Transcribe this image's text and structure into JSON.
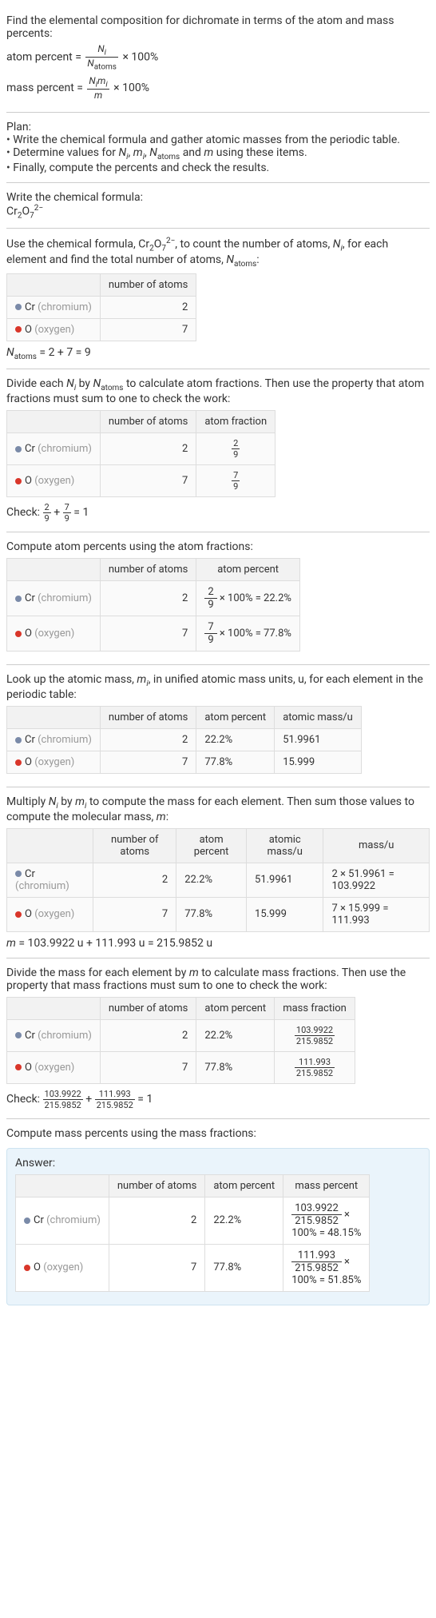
{
  "intro": {
    "line1": "Find the elemental composition for dichromate in terms of the atom and mass percents:",
    "atom_percent_lhs": "atom percent = ",
    "atom_percent_num": "N",
    "atom_percent_num_sub": "i",
    "atom_percent_den": "N",
    "atom_percent_den_sub": "atoms",
    "times100": " × 100%",
    "mass_percent_lhs": "mass percent = ",
    "mass_percent_num": "N",
    "mass_percent_num_sub": "i",
    "mass_percent_num2": "m",
    "mass_percent_num2_sub": "i",
    "mass_percent_den": "m"
  },
  "plan": {
    "title": "Plan:",
    "b1": "• Write the chemical formula and gather atomic masses from the periodic table.",
    "b2a": "• Determine values for ",
    "Ni": "N",
    "Ni_sub": "i",
    "mi": "m",
    "mi_sub": "i",
    "Natoms": "N",
    "Natoms_sub": "atoms",
    "b2b": " and ",
    "m": "m",
    "b2c": " using these items.",
    "b3": "• Finally, compute the percents and check the results."
  },
  "write_formula": {
    "title": "Write the chemical formula:",
    "cr": "Cr",
    "cr_sub": "2",
    "o": "O",
    "o_sub": "7",
    "sup": "2−"
  },
  "count_atoms": {
    "text1": "Use the chemical formula, ",
    "cr": "Cr",
    "cr_sub": "2",
    "o": "O",
    "o_sub": "7",
    "sup": "2−",
    "text2": ", to count the number of atoms, ",
    "Ni": "N",
    "Ni_sub": "i",
    "text3": ", for each element and find the total number of atoms, ",
    "Natoms": "N",
    "Natoms_sub": "atoms",
    "text4": ":",
    "hdr_num": "number of atoms",
    "cr_label": "Cr",
    "cr_gray": "(chromium)",
    "cr_n": "2",
    "o_label": "O",
    "o_gray": "(oxygen)",
    "o_n": "7",
    "sum_lhs": "N",
    "sum_sub": "atoms",
    "sum_rhs": " = 2 + 7 = 9"
  },
  "atom_fractions": {
    "text": "Divide each ",
    "Ni": "N",
    "Ni_sub": "i",
    "text2": " by ",
    "Natoms": "N",
    "Natoms_sub": "atoms",
    "text3": " to calculate atom fractions. Then use the property that atom fractions must sum to one to check the work:",
    "hdr_num": "number of atoms",
    "hdr_frac": "atom fraction",
    "cr_label": "Cr",
    "cr_gray": "(chromium)",
    "cr_n": "2",
    "cr_fn": "2",
    "cr_fd": "9",
    "o_label": "O",
    "o_gray": "(oxygen)",
    "o_n": "7",
    "o_fn": "7",
    "o_fd": "9",
    "check": "Check: ",
    "c1n": "2",
    "c1d": "9",
    "c2n": "7",
    "c2d": "9",
    "eq": " = 1"
  },
  "atom_percents": {
    "title": "Compute atom percents using the atom fractions:",
    "hdr_num": "number of atoms",
    "hdr_ap": "atom percent",
    "cr_label": "Cr",
    "cr_gray": "(chromium)",
    "cr_n": "2",
    "cr_fn": "2",
    "cr_fd": "9",
    "cr_res": " × 100% = 22.2%",
    "o_label": "O",
    "o_gray": "(oxygen)",
    "o_n": "7",
    "o_fn": "7",
    "o_fd": "9",
    "o_res": " × 100% = 77.8%"
  },
  "atomic_mass": {
    "title": "Look up the atomic mass, ",
    "mi": "m",
    "mi_sub": "i",
    "title2": ", in unified atomic mass units, u, for each element in the periodic table:",
    "hdr_num": "number of atoms",
    "hdr_ap": "atom percent",
    "hdr_mass": "atomic mass/u",
    "cr_label": "Cr",
    "cr_gray": "(chromium)",
    "cr_n": "2",
    "cr_ap": "22.2%",
    "cr_m": "51.9961",
    "o_label": "O",
    "o_gray": "(oxygen)",
    "o_n": "7",
    "o_ap": "77.8%",
    "o_m": "15.999"
  },
  "mass_calc": {
    "title": "Multiply ",
    "Ni": "N",
    "Ni_sub": "i",
    "by": " by ",
    "mi": "m",
    "mi_sub": "i",
    "title2": " to compute the mass for each element. Then sum those values to compute the molecular mass, ",
    "m": "m",
    "title3": ":",
    "hdr_num": "number of atoms",
    "hdr_ap": "atom percent",
    "hdr_mass": "atomic mass/u",
    "hdr_m": "mass/u",
    "cr_label": "Cr",
    "cr_gray": "(chromium)",
    "cr_n": "2",
    "cr_ap": "22.2%",
    "cr_am": "51.9961",
    "cr_mass": "2 × 51.9961 = 103.9922",
    "o_label": "O",
    "o_gray": "(oxygen)",
    "o_n": "7",
    "o_ap": "77.8%",
    "o_am": "15.999",
    "o_mass": "7 × 15.999 = 111.993",
    "sum_m": "m",
    "sum": " = 103.9922 u + 111.993 u = 215.9852 u"
  },
  "mass_fractions": {
    "title": "Divide the mass for each element by ",
    "m": "m",
    "title2": " to calculate mass fractions. Then use the property that mass fractions must sum to one to check the work:",
    "hdr_num": "number of atoms",
    "hdr_ap": "atom percent",
    "hdr_mf": "mass fraction",
    "cr_label": "Cr",
    "cr_gray": "(chromium)",
    "cr_n": "2",
    "cr_ap": "22.2%",
    "cr_fn": "103.9922",
    "cr_fd": "215.9852",
    "o_label": "O",
    "o_gray": "(oxygen)",
    "o_n": "7",
    "o_ap": "77.8%",
    "o_fn": "111.993",
    "o_fd": "215.9852",
    "check": "Check: ",
    "c1n": "103.9922",
    "c1d": "215.9852",
    "c2n": "111.993",
    "c2d": "215.9852",
    "eq": " = 1"
  },
  "mass_percents": {
    "title": "Compute mass percents using the mass fractions:",
    "answer_label": "Answer:",
    "hdr_num": "number of atoms",
    "hdr_ap": "atom percent",
    "hdr_mp": "mass percent",
    "cr_label": "Cr",
    "cr_gray": "(chromium)",
    "cr_n": "2",
    "cr_ap": "22.2%",
    "cr_fn": "103.9922",
    "cr_fd": "215.9852",
    "cr_res": "100% = 48.15%",
    "cr_times": " ×",
    "o_label": "O",
    "o_gray": "(oxygen)",
    "o_n": "7",
    "o_ap": "77.8%",
    "o_fn": "111.993",
    "o_fd": "215.9852",
    "o_res": "100% = 51.85%",
    "o_times": " ×"
  }
}
